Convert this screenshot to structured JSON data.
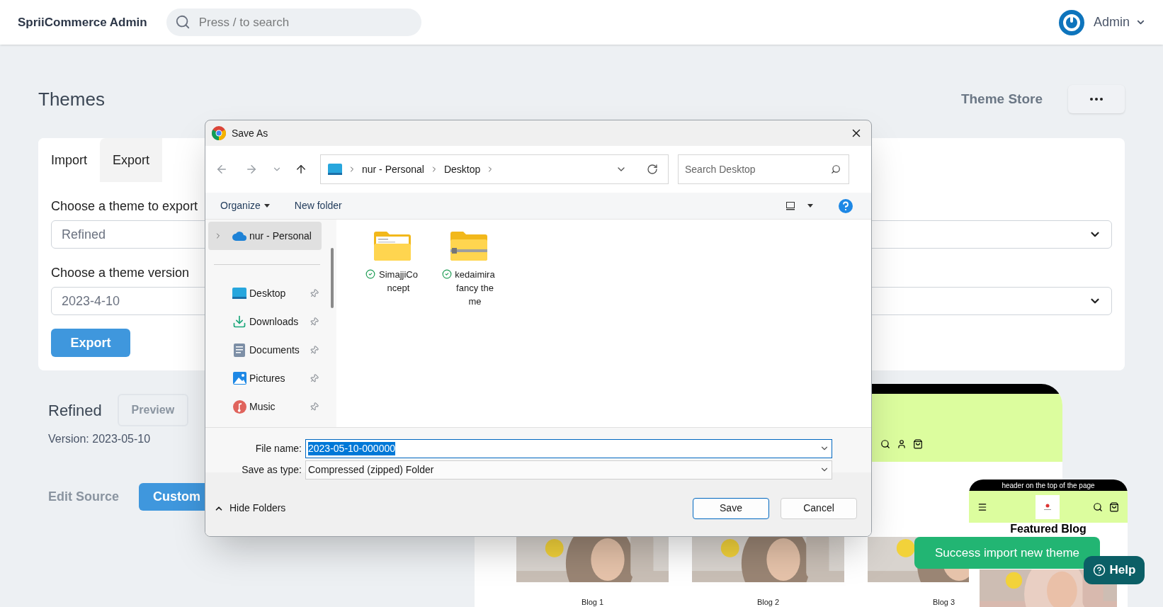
{
  "header": {
    "brand": "SpriiCommerce Admin",
    "search": {
      "placeholder": "Press / to search"
    },
    "user": {
      "name": "Admin"
    }
  },
  "page": {
    "title": "Themes",
    "theme_store": "Theme Store"
  },
  "export_card": {
    "tabs": [
      {
        "label": "Import",
        "selected": false
      },
      {
        "label": "Export",
        "selected": true
      }
    ],
    "fields": [
      {
        "label": "Choose a theme to export",
        "value": "Refined"
      },
      {
        "label": "Choose a theme version",
        "value": "2023-4-10"
      }
    ],
    "button": "Export"
  },
  "current_theme": {
    "name": "Refined",
    "preview": "Preview",
    "version": "Version: 2023-05-10",
    "edit_source": "Edit Source",
    "customize": "Custom"
  },
  "preview": {
    "blogs": [
      {
        "label": "Blog 1"
      },
      {
        "label": "Blog 2"
      },
      {
        "label": "Blog 3"
      }
    ],
    "mobile": {
      "announcement": "header on the top of the page",
      "heading": "Featured Blog"
    }
  },
  "toast": "Success import new theme",
  "help": "Help",
  "dialog": {
    "title": "Save As",
    "path": [
      "nur - Personal",
      "Desktop"
    ],
    "search": {
      "placeholder": "Search Desktop"
    },
    "toolbar": [
      "Organize",
      "New folder"
    ],
    "nav": [
      {
        "label": "nur - Personal",
        "kind": "cloud",
        "selected": true
      },
      {
        "label": "Desktop",
        "kind": "desktop",
        "selected": false
      },
      {
        "label": "Downloads",
        "kind": "downloads",
        "selected": false
      },
      {
        "label": "Documents",
        "kind": "documents",
        "selected": false
      },
      {
        "label": "Pictures",
        "kind": "pictures",
        "selected": false
      },
      {
        "label": "Music",
        "kind": "music",
        "selected": false
      }
    ],
    "files": [
      {
        "name": "SimajjiConcept",
        "kind": "folder"
      },
      {
        "name": "kedaimira fancy theme",
        "kind": "zip"
      }
    ],
    "file_name": {
      "label": "File name:",
      "value": "2023-05-10-000000"
    },
    "save_type": {
      "label": "Save as type:",
      "value": "Compressed (zipped) Folder"
    },
    "hide_folders": "Hide Folders",
    "buttons": [
      "Save",
      "Cancel"
    ]
  }
}
